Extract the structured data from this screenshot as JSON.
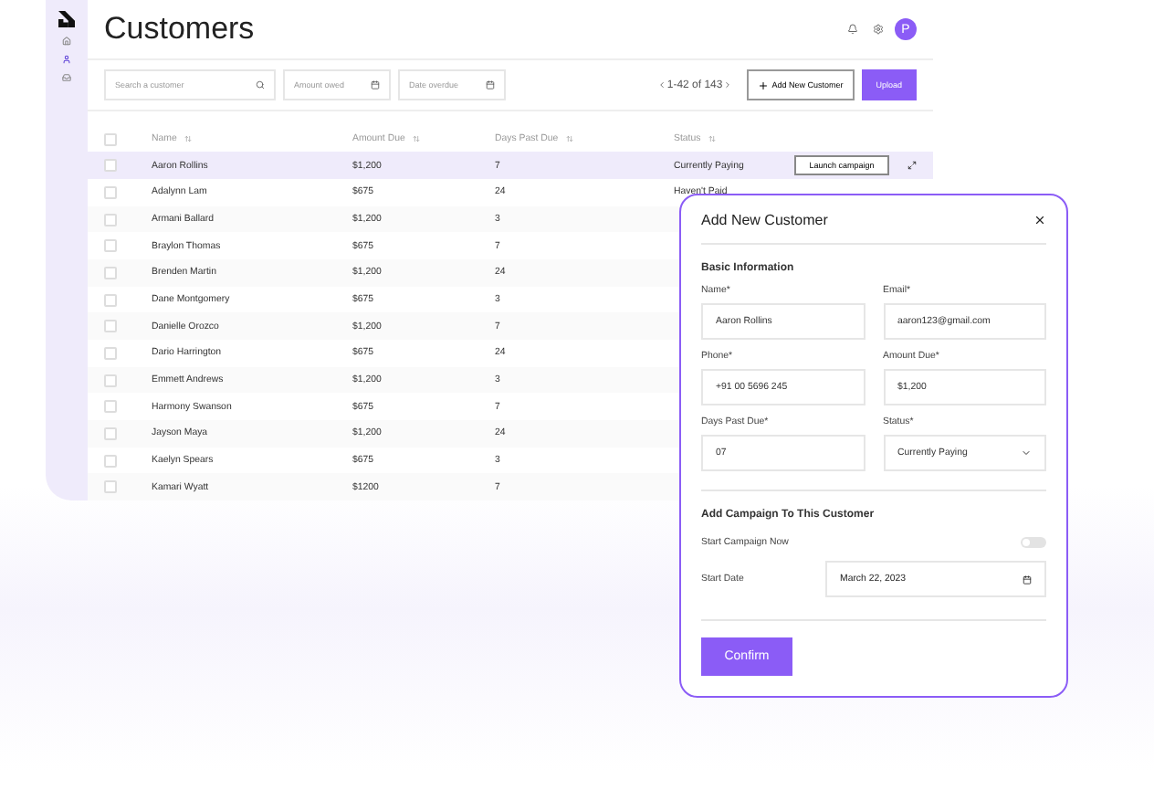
{
  "page": {
    "title": "Customers",
    "avatar": "P"
  },
  "toolbar": {
    "search": {
      "placeholder": "Search a customer"
    },
    "amount_filter": {
      "placeholder": "Amount owed"
    },
    "date_filter": {
      "placeholder": "Date overdue"
    },
    "pagination": "1-42 of 143",
    "add_button": "Add New Customer",
    "upload_button": "Upload"
  },
  "sidebar": {
    "items": [
      {
        "selected": false
      },
      {
        "selected": true
      },
      {
        "selected": false
      }
    ]
  },
  "table": {
    "columns": [
      "Name",
      "Amount Due",
      "Days Past Due",
      "Status"
    ],
    "all_checked": false,
    "rows": [
      {
        "name": "Aaron Rollins",
        "amount": "$1,200",
        "days": "7",
        "status": "Currently Paying",
        "action": "Launch campaign",
        "selected": true,
        "checked": false
      },
      {
        "name": "Adalynn Lam",
        "amount": "$675",
        "days": "24",
        "status": "Haven't Paid",
        "selected": false,
        "checked": false
      },
      {
        "name": "Armani Ballard",
        "amount": "$1,200",
        "days": "3",
        "selected": false,
        "checked": false
      },
      {
        "name": "Braylon Thomas",
        "amount": "$675",
        "days": "7",
        "selected": false,
        "checked": false
      },
      {
        "name": "Brenden Martin",
        "amount": "$1,200",
        "days": "24",
        "selected": false,
        "checked": false
      },
      {
        "name": "Dane Montgomery",
        "amount": "$675",
        "days": "3",
        "selected": false,
        "checked": false
      },
      {
        "name": "Danielle Orozco",
        "amount": "$1,200",
        "days": "7",
        "selected": false,
        "checked": false
      },
      {
        "name": "Dario Harrington",
        "amount": "$675",
        "days": "24",
        "selected": false,
        "checked": false
      },
      {
        "name": "Emmett Andrews",
        "amount": "$1,200",
        "days": "3",
        "selected": false,
        "checked": false
      },
      {
        "name": "Harmony Swanson",
        "amount": "$675",
        "days": "7",
        "selected": false,
        "checked": false
      },
      {
        "name": "Jayson Maya",
        "amount": "$1,200",
        "days": "24",
        "selected": false,
        "checked": false
      },
      {
        "name": "Kaelyn Spears",
        "amount": "$675",
        "days": "3",
        "selected": false,
        "checked": false
      },
      {
        "name": "Kamari Wyatt",
        "amount": "$1200",
        "days": "7",
        "selected": false,
        "checked": false
      }
    ]
  },
  "dialog": {
    "title": "Add New Customer",
    "section_basic": "Basic Information",
    "fields": [
      {
        "label": "Name*",
        "value": "Aaron Rollins",
        "kind": "text"
      },
      {
        "label": "Email*",
        "value": "aaron123@gmail.com",
        "kind": "text"
      },
      {
        "label": "Phone*",
        "value": "+91 00 5696 245",
        "kind": "text"
      },
      {
        "label": "Amount Due*",
        "value": "$1,200",
        "kind": "text"
      },
      {
        "label": "Days Past Due*",
        "value": "07",
        "kind": "text"
      },
      {
        "label": "Status*",
        "value": "Currently Paying",
        "kind": "select"
      }
    ],
    "section_campaign": "Add Campaign To This Customer",
    "start_now": {
      "label": "Start Campaign Now",
      "on": false
    },
    "start_date": {
      "label": "Start Date",
      "value": "March 22, 2023"
    },
    "confirm_button": "Confirm"
  }
}
